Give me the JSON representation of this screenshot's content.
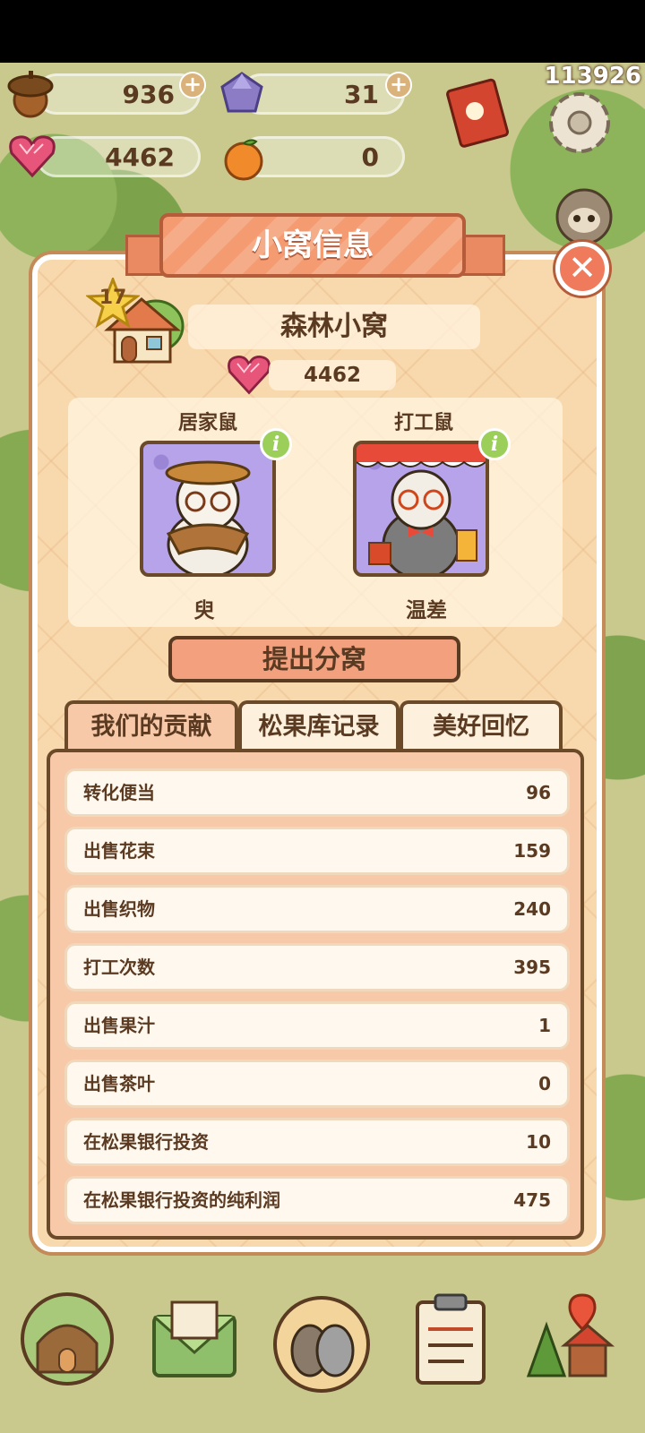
{
  "resources": {
    "acorn": "936",
    "gem": "31",
    "heart": "4462",
    "orange": "0",
    "uid": "113926"
  },
  "panel": {
    "title": "小窝信息",
    "level": "17",
    "house_name": "森林小窝",
    "hearts": "4462",
    "members": [
      {
        "role": "居家鼠",
        "name": "臾"
      },
      {
        "role": "打工鼠",
        "name": "温差"
      }
    ],
    "split_button": "提出分窝",
    "tabs": [
      "我们的贡献",
      "松果库记录",
      "美好回忆"
    ],
    "stats": [
      {
        "label": "转化便当",
        "value": "96"
      },
      {
        "label": "出售花束",
        "value": "159"
      },
      {
        "label": "出售织物",
        "value": "240"
      },
      {
        "label": "打工次数",
        "value": "395"
      },
      {
        "label": "出售果汁",
        "value": "1"
      },
      {
        "label": "出售茶叶",
        "value": "0"
      },
      {
        "label": "在松果银行投资",
        "value": "10"
      },
      {
        "label": "在松果银行投资的纯利润",
        "value": "475"
      }
    ]
  },
  "colors": {
    "accent": "#f59b72",
    "panel_bg": "#f8d9ad",
    "text": "#5b3a22",
    "border": "#6b4a2a"
  }
}
